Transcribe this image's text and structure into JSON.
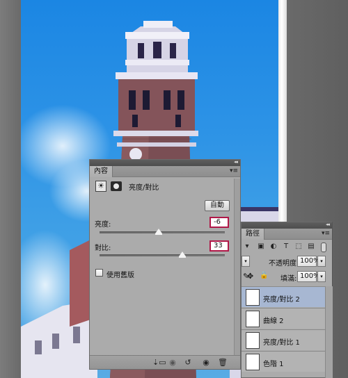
{
  "properties_panel": {
    "tab_label": "內容",
    "collapse_glyph": "◂◂",
    "menu_glyph": "▾≡",
    "adjustment_title": "亮度/對比",
    "auto_button": "自動",
    "brightness": {
      "label": "亮度:",
      "value": "-6",
      "slider_fraction": 0.47
    },
    "contrast": {
      "label": "對比:",
      "value": "33",
      "slider_fraction": 0.66
    },
    "legacy_checkbox": {
      "label": "使用舊版",
      "checked": false
    },
    "footer_icons": [
      "clip-to-layer-icon",
      "eye-preview-icon",
      "reset-icon",
      "visibility-icon",
      "trash-icon"
    ]
  },
  "layers_panel": {
    "tab_label": "路徑",
    "collapse_glyph": "◂◂",
    "menu_glyph": "▾≡",
    "opacity_label": "不透明度:",
    "opacity_value": "100%",
    "fill_label": "填滿:",
    "fill_value": "100%",
    "layers": [
      {
        "name": "亮度/對比 2",
        "selected": true
      },
      {
        "name": "曲線 2",
        "selected": false
      },
      {
        "name": "亮度/對比 1",
        "selected": false
      },
      {
        "name": "色階 1",
        "selected": false
      }
    ]
  },
  "colors": {
    "selected_layer": "#a7b7d2",
    "value_highlight": "#b01848",
    "panel_bg": "#ababab"
  }
}
